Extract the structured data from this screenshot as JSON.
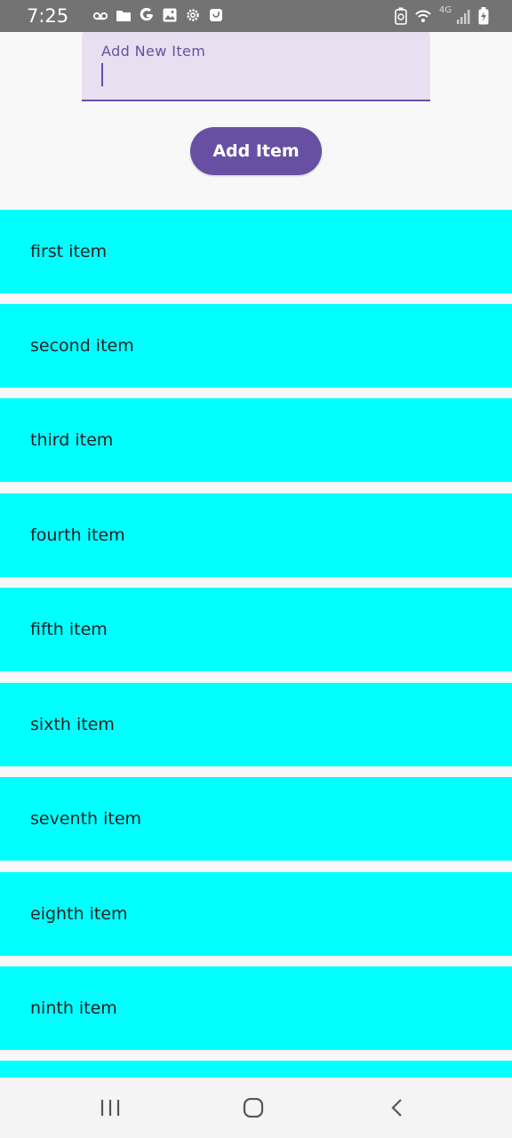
{
  "status_bar": {
    "time": "7:25",
    "left_icons": [
      "voicemail-icon",
      "folder-icon",
      "google-icon",
      "image-icon",
      "settings-icon",
      "app-icon"
    ],
    "right_icons": [
      "battery-saver-icon",
      "wifi-icon",
      "4g-signal-icon",
      "battery-charging-icon"
    ],
    "network_label": "4G"
  },
  "input": {
    "label": "Add New Item",
    "value": ""
  },
  "add_button": {
    "label": "Add Item"
  },
  "list": {
    "items": [
      {
        "label": "first item"
      },
      {
        "label": "second item"
      },
      {
        "label": "third item"
      },
      {
        "label": "fourth item"
      },
      {
        "label": "fifth item"
      },
      {
        "label": "sixth item"
      },
      {
        "label": "seventh item"
      },
      {
        "label": "eighth item"
      },
      {
        "label": "ninth item"
      },
      {
        "label": ""
      }
    ]
  },
  "nav_bar": {
    "buttons": [
      "recents-icon",
      "home-icon",
      "back-icon"
    ]
  },
  "colors": {
    "accent": "#6750a4",
    "input_bg": "#e8dff0",
    "list_item_bg": "#00ffff",
    "status_bar_bg": "#737373"
  }
}
